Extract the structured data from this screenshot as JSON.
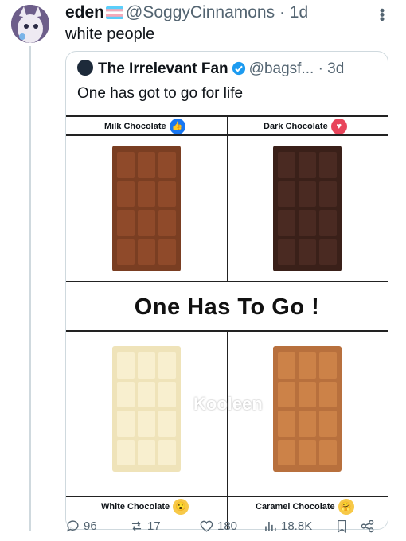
{
  "tweet": {
    "author_name": "eden",
    "handle": "@SoggyCinnamons",
    "time": "· 1d",
    "text": "white people",
    "more_icon": "more-icon"
  },
  "quote": {
    "author_name": "The Irrelevant Fan",
    "handle": "@bagsf...",
    "time": "· 3d",
    "text": "One has got to go for life"
  },
  "poster": {
    "title": "One Has To Go !",
    "watermark": "Kooleen",
    "panels": [
      {
        "label": "Milk Chocolate",
        "reaction": "like-icon",
        "bar_color": "#7a3e22",
        "segment_color": "#8f4a2a"
      },
      {
        "label": "Dark Chocolate",
        "reaction": "love-icon",
        "bar_color": "#3a2019",
        "segment_color": "#4a2a22"
      },
      {
        "label": "White Chocolate",
        "reaction": "wow-icon",
        "bar_color": "#efe3b9",
        "segment_color": "#f8efcf"
      },
      {
        "label": "Caramel Chocolate",
        "reaction": "care-icon",
        "bar_color": "#b8703d",
        "segment_color": "#cc8248"
      }
    ]
  },
  "actions": {
    "replies": "96",
    "reposts": "17",
    "likes": "180",
    "views": "18.8K"
  },
  "colors": {
    "text": "#0f1419",
    "muted": "#536471",
    "border": "#cfd9de",
    "verified": "#1d9bf0"
  }
}
